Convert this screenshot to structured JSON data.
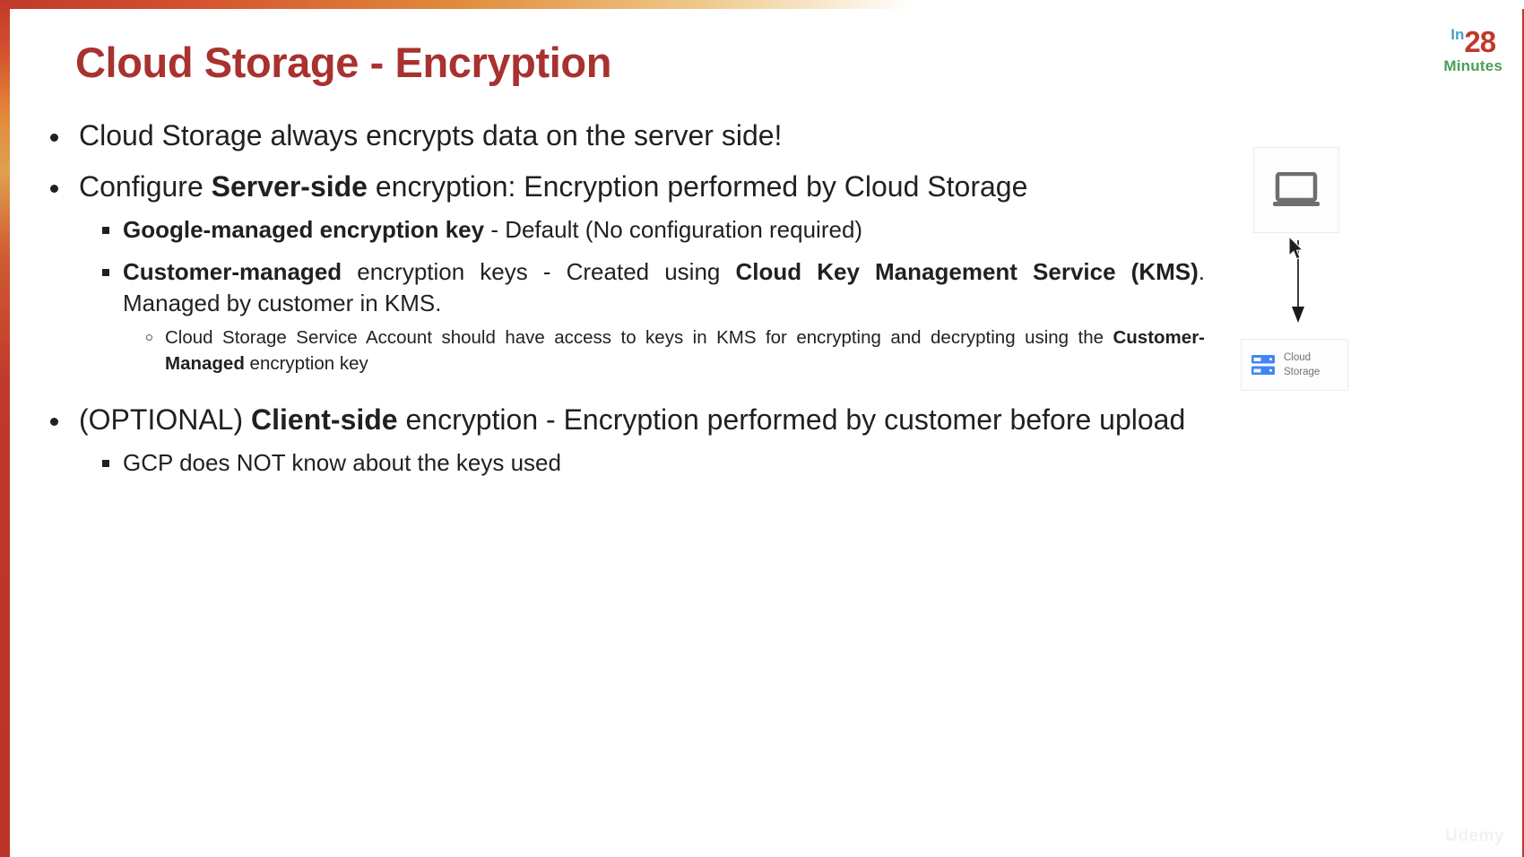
{
  "slide": {
    "title": "Cloud Storage - Encryption",
    "title_color": "#a8322f",
    "accent_color": "#c0392b",
    "watermark": "Udemy"
  },
  "logo": {
    "in": "In",
    "number": "28",
    "minutes": "Minutes",
    "in_color": "#4aa3c7",
    "number_color": "#c0392b",
    "minutes_color": "#49a054"
  },
  "bullets": {
    "b1": {
      "text": "Cloud Storage always encrypts data on the server side!"
    },
    "b2": {
      "pre": "Configure ",
      "bold": "Server-side",
      "post": " encryption: Encryption performed by Cloud Storage",
      "sub": {
        "s1": {
          "bold": "Google-managed encryption key",
          "post": " - Default (No configuration required)"
        },
        "s2": {
          "bold1": "Customer-managed",
          "mid": " encryption keys - Created using ",
          "bold2": "Cloud Key Management Service (KMS)",
          "post": ". Managed by customer in KMS.",
          "sub": {
            "t1": {
              "pre": "Cloud Storage Service Account should have access to keys in KMS for encrypting and decrypting using the ",
              "bold": "Customer-Managed",
              "post": " encryption key"
            }
          }
        }
      }
    },
    "b3": {
      "pre": "(OPTIONAL) ",
      "bold": "Client-side",
      "post": " encryption - Encryption performed by customer before upload",
      "sub": {
        "s1": {
          "text": "GCP does NOT know about the keys used"
        }
      }
    }
  },
  "diagram": {
    "laptop": {
      "icon": "laptop-icon"
    },
    "arrow": {
      "icon": "down-arrow-icon"
    },
    "storage": {
      "icon": "cloud-storage-icon",
      "label_line1": "Cloud",
      "label_line2": "Storage",
      "icon_color": "#4285f4"
    },
    "cursor": {
      "icon": "mouse-cursor-icon"
    }
  }
}
